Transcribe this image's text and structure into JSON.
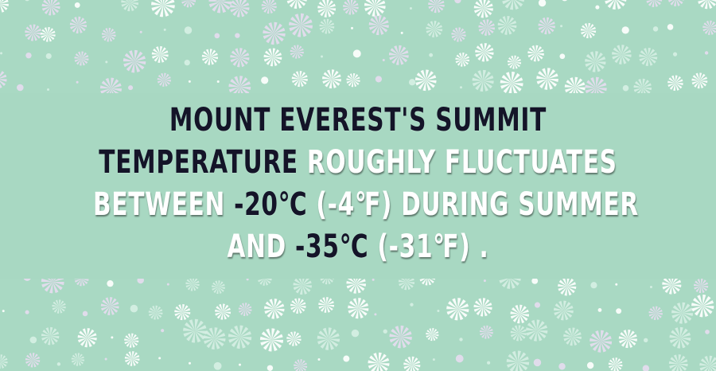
{
  "fact": {
    "line1": [
      {
        "text": "MOUNT EVEREST'S SUMMIT",
        "style": "dark"
      }
    ],
    "line2": [
      {
        "text": "TEMPERATURE",
        "style": "dark"
      },
      {
        "text": " ROUGHLY FLUCTUATES",
        "style": "light"
      }
    ],
    "line3": [
      {
        "text": "BETWEEN ",
        "style": "light"
      },
      {
        "text": "-20",
        "style": "dark"
      },
      {
        "text": "℃",
        "style": "dark"
      },
      {
        "text": " (-4℉) DURING SUMMER",
        "style": "light"
      }
    ],
    "line4": [
      {
        "text": "AND ",
        "style": "light"
      },
      {
        "text": "-35",
        "style": "dark"
      },
      {
        "text": "℃",
        "style": "dark"
      },
      {
        "text": " (-31℉) .",
        "style": "light"
      }
    ]
  },
  "colors": {
    "background": "#a9d9c3",
    "dark_text": "#141428",
    "light_text": "#ffffff",
    "pattern_white": "#ffffff",
    "pattern_lavender": "#e6dcf0",
    "pattern_mint": "#d6efe4"
  }
}
